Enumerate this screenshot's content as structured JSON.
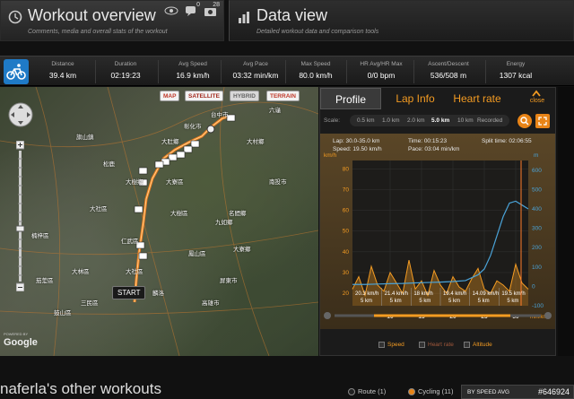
{
  "header": {
    "overview_title": "Workout overview",
    "overview_sub": "Comments, media and overall stats of the workout",
    "data_title": "Data view",
    "data_sub": "Detailed workout data and comparison tools",
    "icon_counts": {
      "views": "",
      "comments": "0",
      "photos": "28"
    }
  },
  "stats": [
    {
      "label": "Distance",
      "value": "39.4 km"
    },
    {
      "label": "Duration",
      "value": "02:19:23"
    },
    {
      "label": "Avg Speed",
      "value": "16.9 km/h"
    },
    {
      "label": "Avg Pace",
      "value": "03:32 min/km"
    },
    {
      "label": "Max Speed",
      "value": "80.0 km/h"
    },
    {
      "label": "HR Avg/HR Max",
      "value": "0/0 bpm"
    },
    {
      "label": "Ascent/Descent",
      "value": "536/508 m"
    },
    {
      "label": "Energy",
      "value": "1307 kcal"
    }
  ],
  "map": {
    "buttons": [
      "MAP",
      "SATELLITE",
      "HYBRID",
      "TERRAIN"
    ],
    "start_label": "START",
    "powered": "POWERED BY",
    "google": "Google",
    "labels": [
      "台中市",
      "大肚鄉",
      "彰化市",
      "大村鄉",
      "南投市",
      "名間鄉",
      "九如鄉",
      "大寮鄉",
      "屏東市",
      "鳳山區",
      "楠梓區",
      "大社區",
      "大樹區",
      "麟洛",
      "仁武區",
      "大樹鄉",
      "大寮區",
      "三民區",
      "高雄市",
      "大林區",
      "鼓山區",
      "松鹿",
      "旗山鎮",
      "大社區",
      "茄萣區",
      "六龜"
    ]
  },
  "panel": {
    "tabs": [
      "Profile",
      "Lap Info",
      "Heart rate"
    ],
    "close": "close",
    "scale_label": "Scale:",
    "scale_options": [
      "0.5 km",
      "1.0 km",
      "2.0 km",
      "5.0 km",
      "10 km",
      "Recorded"
    ],
    "info": {
      "lap": "Lap: 30.0-35.0 km",
      "speed": "Speed: 19.50 km/h",
      "time": "Time: 00:15:23",
      "pace": "Pace: 03:04 min/km",
      "split": "Split time: 02:06:55"
    },
    "legend": [
      "Speed",
      "Heart rate",
      "Altitude"
    ]
  },
  "chart_data": {
    "type": "line",
    "x_unit": "min/km",
    "y_left_unit": "km/h",
    "y_right_unit": "m",
    "x_ticks": [
      10,
      15,
      20,
      25,
      30
    ],
    "y_left_ticks": [
      80,
      70,
      60,
      50,
      40,
      30,
      20
    ],
    "y_right_ticks": [
      600,
      500,
      400,
      300,
      200,
      100,
      0,
      -100
    ],
    "xlim": [
      4,
      32
    ],
    "y_left_lim": [
      14,
      84
    ],
    "y_right_lim": [
      -100,
      650
    ],
    "series": [
      {
        "name": "Speed",
        "color": "#f39b22",
        "x": [
          4,
          5,
          6,
          7,
          8,
          9,
          10,
          11,
          12,
          13,
          14,
          15,
          16,
          17,
          18,
          19,
          20,
          21,
          22,
          23,
          24,
          25,
          26,
          27,
          28,
          29,
          30,
          31,
          32
        ],
        "values": [
          22,
          28,
          19,
          33,
          24,
          21,
          30,
          25,
          20,
          36,
          22,
          26,
          19,
          31,
          24,
          20,
          28,
          23,
          21,
          27,
          32,
          22,
          20,
          26,
          24,
          21,
          34,
          25,
          22
        ]
      },
      {
        "name": "Altitude",
        "color": "#4aa3d8",
        "x": [
          4,
          6,
          8,
          10,
          12,
          14,
          16,
          18,
          20,
          22,
          24,
          25,
          26,
          27,
          28,
          29,
          30,
          31,
          32
        ],
        "values": [
          10,
          10,
          12,
          14,
          15,
          18,
          20,
          22,
          25,
          30,
          60,
          90,
          160,
          260,
          360,
          430,
          440,
          420,
          400
        ]
      }
    ],
    "lap_labels": [
      {
        "speed": "20.3 km/h",
        "dist": "5 km"
      },
      {
        "speed": "21.4 km/h",
        "dist": "5 km"
      },
      {
        "speed": "18 km/h",
        "dist": "5 km"
      },
      {
        "speed": "19.4 km/h",
        "dist": "5 km"
      },
      {
        "speed": "14.09 km/h",
        "dist": "5 km"
      },
      {
        "speed": "19.5 km/h",
        "dist": "5 km"
      }
    ]
  },
  "bottom": {
    "title": "naferla's other workouts",
    "route": "Route (1)",
    "cycling": "Cycling (11)",
    "sort": "BY SPEED AVG",
    "code": "#646924"
  },
  "colors": {
    "accent": "#f39b22",
    "sport": "#1f7ac6",
    "altitude": "#4aa3d8"
  }
}
